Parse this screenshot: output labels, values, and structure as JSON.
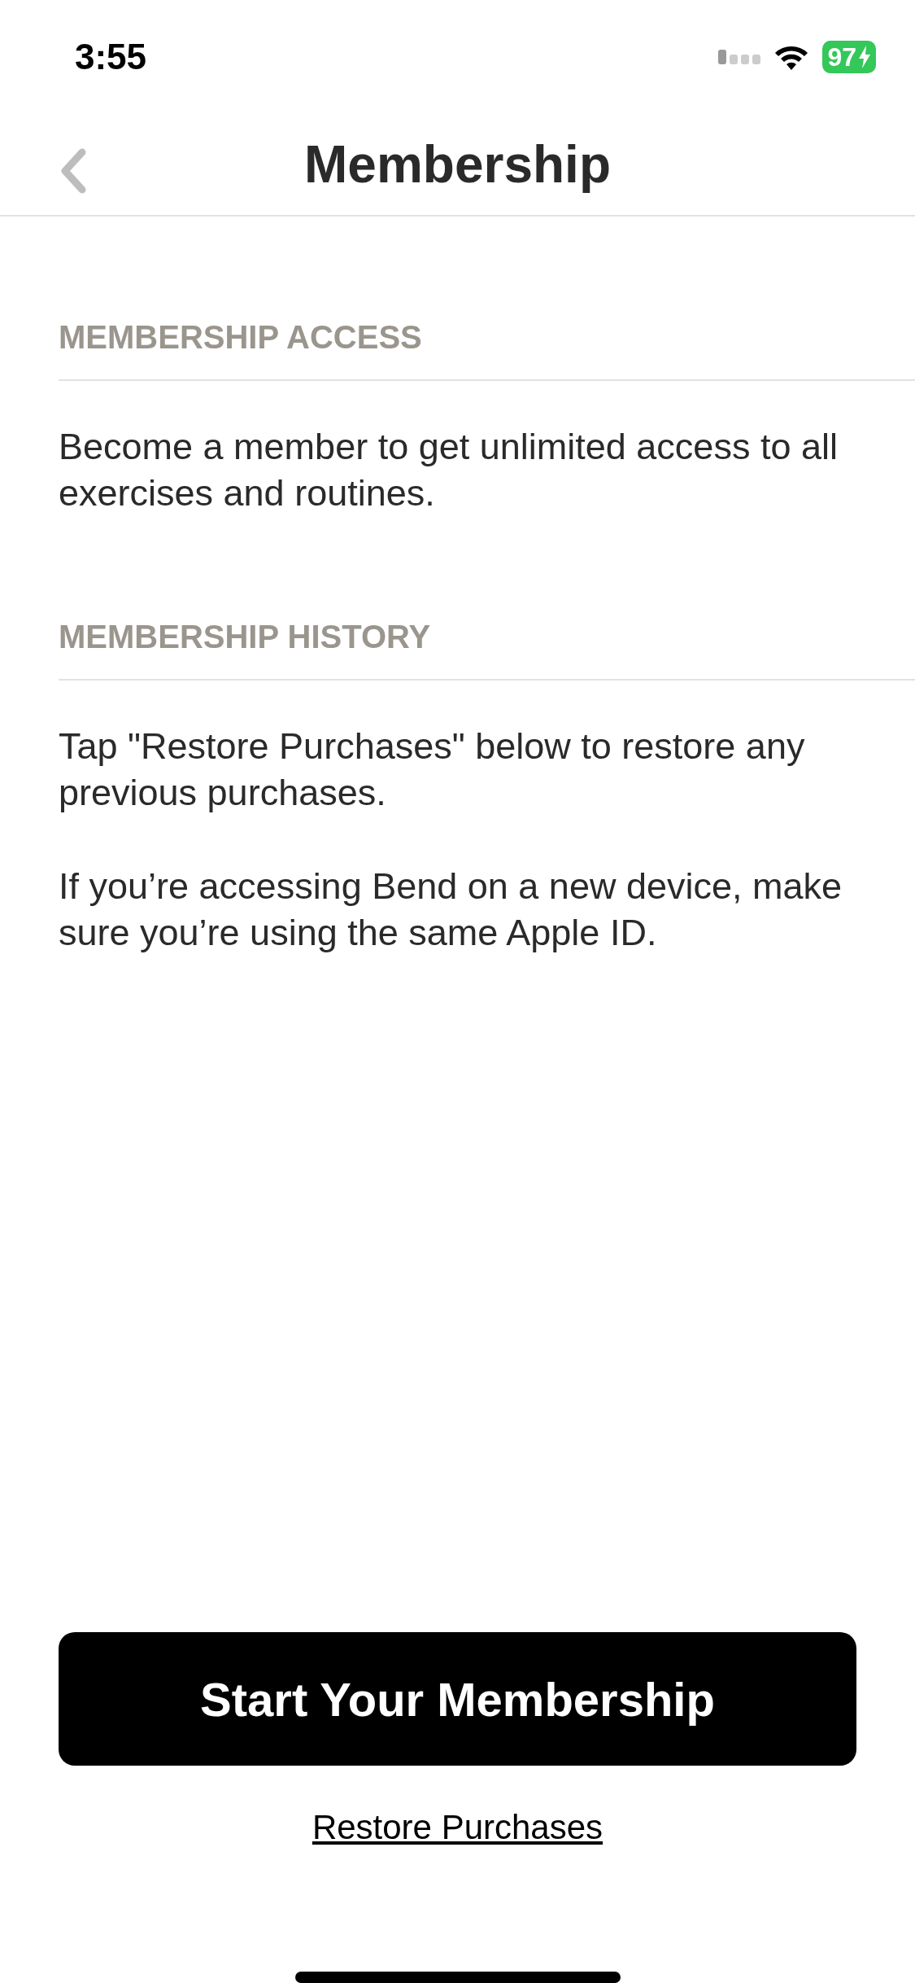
{
  "status_bar": {
    "time": "3:55",
    "battery": "97"
  },
  "nav": {
    "title": "Membership"
  },
  "sections": [
    {
      "header": "MEMBERSHIP ACCESS",
      "paragraphs": [
        "Become a member to get unlimited access to all exercises and routines."
      ]
    },
    {
      "header": "MEMBERSHIP HISTORY",
      "paragraphs": [
        "Tap \"Restore Purchases\" below to restore any previous purchases.",
        "If you’re accessing Bend on a new device, make sure you’re using the same Apple ID."
      ]
    }
  ],
  "primary_button": "Start Your Membership",
  "link": "Restore Purchases"
}
